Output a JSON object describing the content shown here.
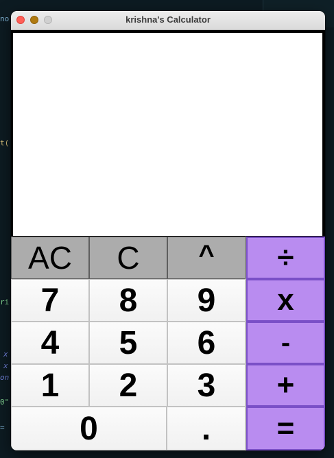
{
  "window": {
    "title": "krishna's Calculator"
  },
  "display": {
    "value": ""
  },
  "keypad": {
    "function_keys": {
      "all_clear": "AC",
      "clear": "C",
      "power": "^"
    },
    "operators": {
      "divide": "÷",
      "multiply": "x",
      "subtract": "-",
      "add": "+",
      "equals": "="
    },
    "digits": {
      "d7": "7",
      "d8": "8",
      "d9": "9",
      "d4": "4",
      "d5": "5",
      "d6": "6",
      "d1": "1",
      "d2": "2",
      "d3": "3",
      "d0": "0",
      "decimal": "."
    }
  },
  "background_editor": {
    "fragments": [
      "no",
      "t(",
      "ri",
      "x",
      "x",
      "on",
      "0\"",
      "="
    ]
  },
  "colors": {
    "operator_key": "#b98cf0",
    "operator_border": "#7a4fc7",
    "function_key": "#acacac",
    "digit_key": "#f5f5f5",
    "close_light": "#ff5f57",
    "minimize_light": "#b07a10",
    "desktop_background": "#0d1b22"
  }
}
